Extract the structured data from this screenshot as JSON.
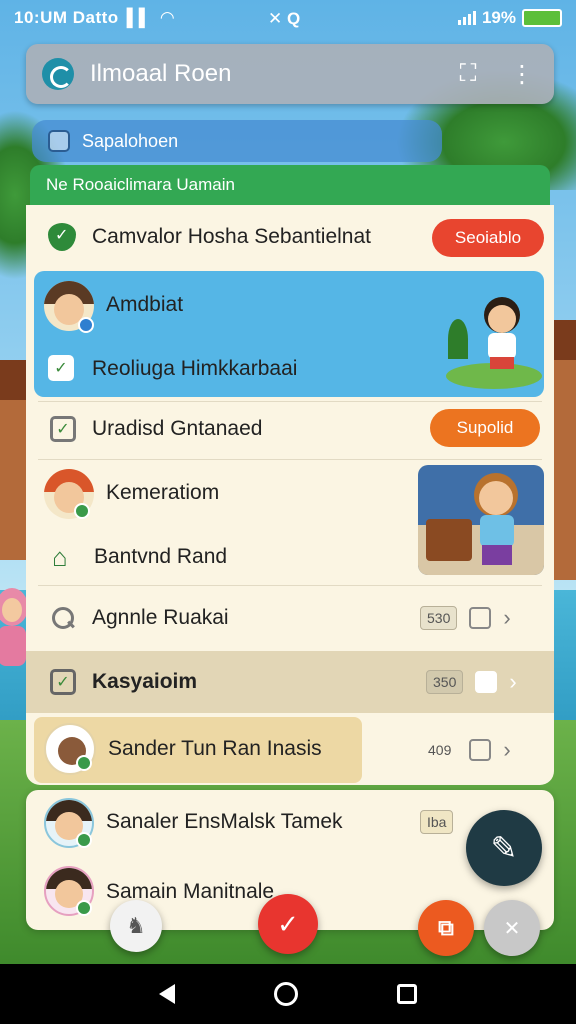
{
  "status_bar": {
    "time": "10:UM Datto",
    "mid_icons": "✕ Q",
    "battery_text": "19%"
  },
  "top_bar": {
    "title": "Ilmoaal Roen"
  },
  "search": {
    "text": "Sapalohoen"
  },
  "banner": {
    "text": "Ne Rooaiclimara Uamain"
  },
  "rows": [
    {
      "label": "Camvalor Hosha Sebantielnat",
      "pill": "Seoiablo",
      "pill_color": "#e8452f"
    },
    {
      "label": "Amdbiat"
    },
    {
      "label": "Reoliuga Himkkarbaai"
    },
    {
      "label": "Uradisd Gntanaed",
      "pill": "Supolid",
      "pill_color": "#ec7420"
    },
    {
      "label": "Kemeratiom"
    },
    {
      "label": "Bantvnd Rand"
    },
    {
      "label": "Agnnle Ruakai",
      "chip": "530"
    },
    {
      "label": "Kasyaioim",
      "chip": "350"
    },
    {
      "label": "Sander Tun Ran Inasis",
      "chip": "409"
    },
    {
      "label": "Sanaler EnsMalsk Tamek",
      "chip": "Iba"
    },
    {
      "label": "Samain Manitnale"
    }
  ],
  "colors": {
    "accent_green": "#33a853",
    "highlight_blue": "#55b6e6",
    "card_bg": "#fbf5e3",
    "pill_red": "#e8452f",
    "pill_orange": "#ec7420",
    "fab_dark": "#1f3a44"
  }
}
